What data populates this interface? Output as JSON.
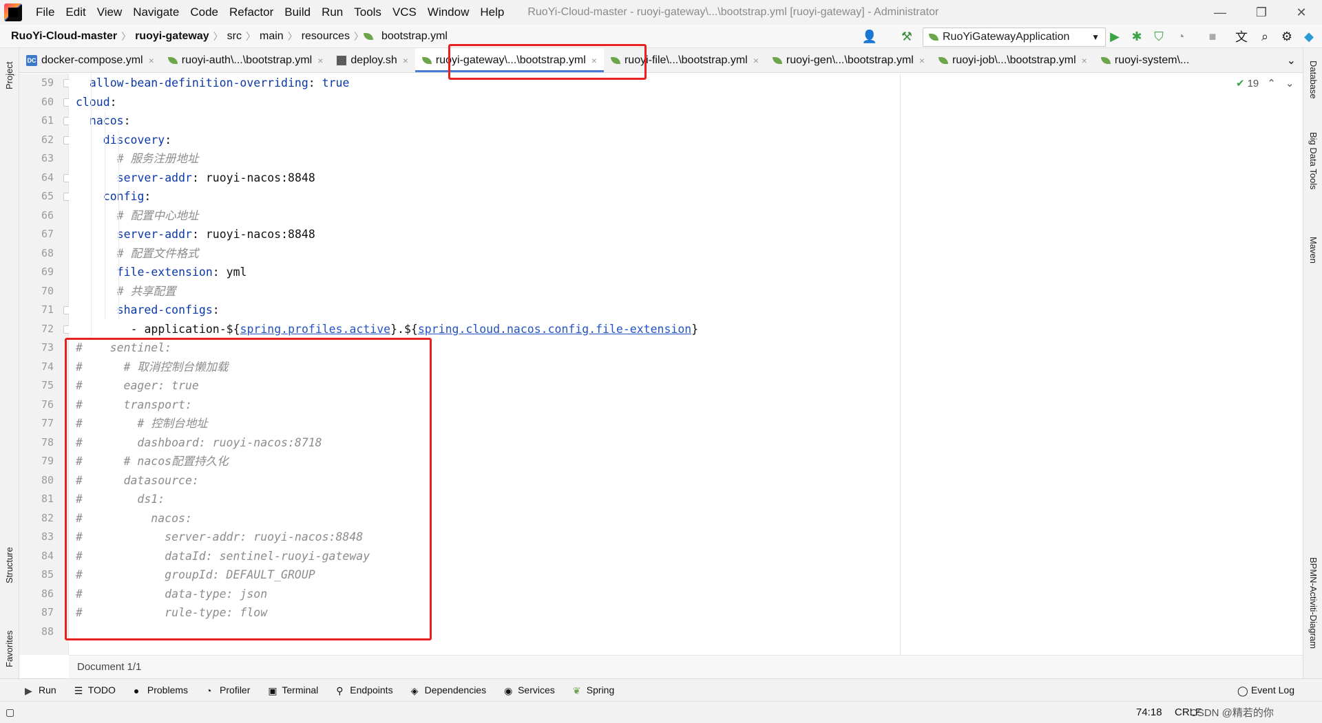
{
  "title_bar": {
    "menu": [
      "File",
      "Edit",
      "View",
      "Navigate",
      "Code",
      "Refactor",
      "Build",
      "Run",
      "Tools",
      "VCS",
      "Window",
      "Help"
    ],
    "window_title": "RuoYi-Cloud-master - ruoyi-gateway\\...\\bootstrap.yml [ruoyi-gateway] - Administrator",
    "minimize": "—",
    "restore": "❐",
    "close": "✕"
  },
  "nav_bar": {
    "breadcrumbs": [
      "RuoYi-Cloud-master",
      "ruoyi-gateway",
      "src",
      "main",
      "resources",
      "bootstrap.yml"
    ],
    "run_config": "RuoYiGatewayApplication"
  },
  "tabs": [
    {
      "label": "docker-compose.yml",
      "icon": "docker-compose-icon",
      "active": false
    },
    {
      "label": "ruoyi-auth\\...\\bootstrap.yml",
      "icon": "yaml-icon",
      "active": false
    },
    {
      "label": "deploy.sh",
      "icon": "shell-icon",
      "active": false
    },
    {
      "label": "ruoyi-gateway\\...\\bootstrap.yml",
      "icon": "yaml-icon",
      "active": true
    },
    {
      "label": "ruoyi-file\\...\\bootstrap.yml",
      "icon": "yaml-icon",
      "active": false
    },
    {
      "label": "ruoyi-gen\\...\\bootstrap.yml",
      "icon": "yaml-icon",
      "active": false
    },
    {
      "label": "ruoyi-job\\...\\bootstrap.yml",
      "icon": "yaml-icon",
      "active": false
    },
    {
      "label": "ruoyi-system\\...",
      "icon": "yaml-icon",
      "active": false
    }
  ],
  "tab_close": "×",
  "left_tools": [
    "Project",
    "Structure",
    "Favorites"
  ],
  "right_tools": [
    "Database",
    "Big Data Tools",
    "Maven",
    "BPMN-Activiti-Diagram"
  ],
  "inspection_count": "19",
  "code_lines": [
    {
      "n": "59",
      "indent": 2,
      "parts": [
        {
          "t": "allow-bean-definition-overriding",
          "c": "k"
        },
        {
          "t": ": ",
          "c": "p"
        },
        {
          "t": "true",
          "c": "k"
        }
      ]
    },
    {
      "n": "60",
      "indent": 0,
      "parts": [
        {
          "t": "cloud",
          "c": "k"
        },
        {
          "t": ":",
          "c": "p"
        }
      ]
    },
    {
      "n": "61",
      "indent": 2,
      "parts": [
        {
          "t": "nacos",
          "c": "k"
        },
        {
          "t": ":",
          "c": "p"
        }
      ]
    },
    {
      "n": "62",
      "indent": 4,
      "parts": [
        {
          "t": "discovery",
          "c": "k"
        },
        {
          "t": ":",
          "c": "p"
        }
      ]
    },
    {
      "n": "63",
      "indent": 6,
      "parts": [
        {
          "t": "# 服务注册地址",
          "c": "c"
        }
      ]
    },
    {
      "n": "64",
      "indent": 6,
      "parts": [
        {
          "t": "server-addr",
          "c": "k"
        },
        {
          "t": ": ruoyi-nacos:8848",
          "c": "p"
        }
      ]
    },
    {
      "n": "65",
      "indent": 4,
      "parts": [
        {
          "t": "config",
          "c": "k"
        },
        {
          "t": ":",
          "c": "p"
        }
      ]
    },
    {
      "n": "66",
      "indent": 6,
      "parts": [
        {
          "t": "# 配置中心地址",
          "c": "c"
        }
      ]
    },
    {
      "n": "67",
      "indent": 6,
      "parts": [
        {
          "t": "server-addr",
          "c": "k"
        },
        {
          "t": ": ruoyi-nacos:8848",
          "c": "p"
        }
      ]
    },
    {
      "n": "68",
      "indent": 6,
      "parts": [
        {
          "t": "# 配置文件格式",
          "c": "c"
        }
      ]
    },
    {
      "n": "69",
      "indent": 6,
      "parts": [
        {
          "t": "file-extension",
          "c": "k"
        },
        {
          "t": ": yml",
          "c": "p"
        }
      ]
    },
    {
      "n": "70",
      "indent": 6,
      "parts": [
        {
          "t": "# 共享配置",
          "c": "c"
        }
      ]
    },
    {
      "n": "71",
      "indent": 6,
      "parts": [
        {
          "t": "shared-configs",
          "c": "k"
        },
        {
          "t": ":",
          "c": "p"
        }
      ]
    },
    {
      "n": "72",
      "indent": 8,
      "parts": [
        {
          "t": "- application-${",
          "c": "p"
        },
        {
          "t": "spring.profiles.active",
          "c": "u"
        },
        {
          "t": "}.${",
          "c": "p"
        },
        {
          "t": "spring.cloud.nacos.config.file-extension",
          "c": "u"
        },
        {
          "t": "}",
          "c": "p"
        }
      ]
    },
    {
      "n": "73",
      "indent": 0,
      "parts": [
        {
          "t": "#    sentinel:",
          "c": "c"
        }
      ]
    },
    {
      "n": "74",
      "indent": 0,
      "parts": [
        {
          "t": "#      # 取消控制台懒加载",
          "c": "c"
        }
      ]
    },
    {
      "n": "75",
      "indent": 0,
      "parts": [
        {
          "t": "#      eager: true",
          "c": "c"
        }
      ]
    },
    {
      "n": "76",
      "indent": 0,
      "parts": [
        {
          "t": "#      transport:",
          "c": "c"
        }
      ]
    },
    {
      "n": "77",
      "indent": 0,
      "parts": [
        {
          "t": "#        # 控制台地址",
          "c": "c"
        }
      ]
    },
    {
      "n": "78",
      "indent": 0,
      "parts": [
        {
          "t": "#        dashboard: ruoyi-nacos:8718",
          "c": "c"
        }
      ]
    },
    {
      "n": "79",
      "indent": 0,
      "parts": [
        {
          "t": "#      # nacos配置持久化",
          "c": "c"
        }
      ]
    },
    {
      "n": "80",
      "indent": 0,
      "parts": [
        {
          "t": "#      datasource:",
          "c": "c"
        }
      ]
    },
    {
      "n": "81",
      "indent": 0,
      "parts": [
        {
          "t": "#        ds1:",
          "c": "c"
        }
      ]
    },
    {
      "n": "82",
      "indent": 0,
      "parts": [
        {
          "t": "#          nacos:",
          "c": "c"
        }
      ]
    },
    {
      "n": "83",
      "indent": 0,
      "parts": [
        {
          "t": "#            server-addr: ruoyi-nacos:8848",
          "c": "c"
        }
      ]
    },
    {
      "n": "84",
      "indent": 0,
      "parts": [
        {
          "t": "#            dataId: sentinel-ruoyi-gateway",
          "c": "c"
        }
      ]
    },
    {
      "n": "85",
      "indent": 0,
      "parts": [
        {
          "t": "#            groupId: DEFAULT_GROUP",
          "c": "c"
        }
      ]
    },
    {
      "n": "86",
      "indent": 0,
      "parts": [
        {
          "t": "#            data-type: json",
          "c": "c"
        }
      ]
    },
    {
      "n": "87",
      "indent": 0,
      "parts": [
        {
          "t": "#            rule-type: flow",
          "c": "c"
        }
      ]
    },
    {
      "n": "88",
      "indent": 0,
      "parts": []
    }
  ],
  "doc_breadcrumb": "Document 1/1",
  "tool_windows": [
    "Run",
    "TODO",
    "Problems",
    "Profiler",
    "Terminal",
    "Endpoints",
    "Dependencies",
    "Services",
    "Spring"
  ],
  "event_log": "Event Log",
  "status": {
    "position": "74:18",
    "line_sep": "CRLF",
    "watermark": "CSDN @精若的你"
  },
  "colors": {
    "accent": "#4a7bd4",
    "highlight_box": "#e8201e",
    "keyword": "#0b38a8",
    "comment": "#8c8c8c"
  }
}
